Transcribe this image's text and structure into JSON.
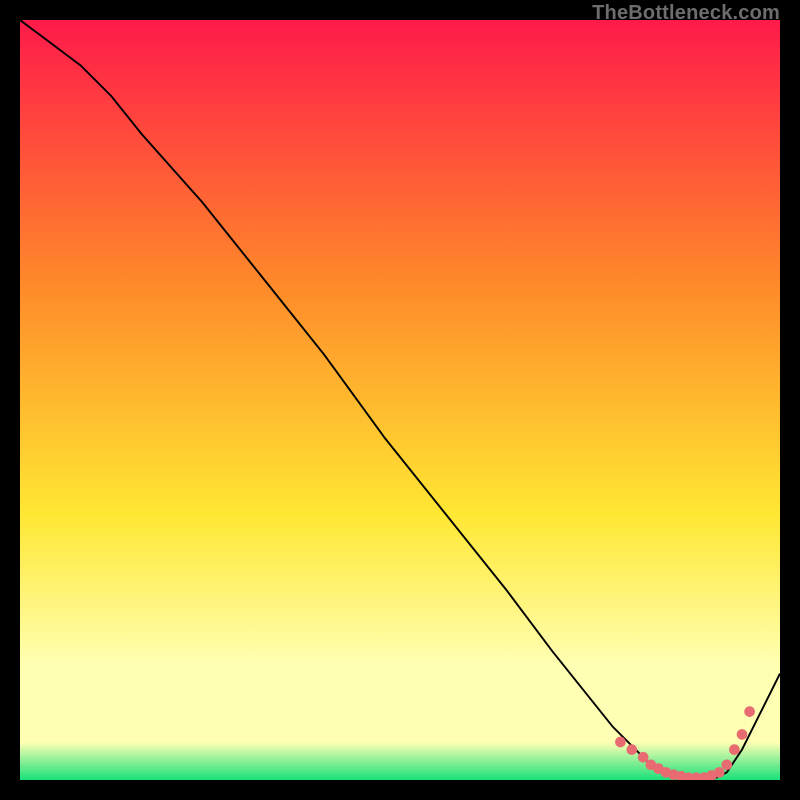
{
  "watermark": "TheBottleneck.com",
  "colors": {
    "line": "#000000",
    "dots": "#e86b72",
    "gradient_top": "#ff1a4a",
    "gradient_mid1": "#ff8a2a",
    "gradient_mid2": "#ffe733",
    "gradient_pale": "#ffffb3",
    "gradient_green": "#18e07a"
  },
  "chart_data": {
    "type": "line",
    "title": "",
    "xlabel": "",
    "ylabel": "",
    "xlim": [
      0,
      100
    ],
    "ylim": [
      0,
      100
    ],
    "grid": false,
    "series": [
      {
        "name": "curve",
        "x": [
          0,
          4,
          8,
          12,
          16,
          24,
          32,
          40,
          48,
          56,
          64,
          70,
          74,
          78,
          81,
          83,
          85,
          87,
          89,
          91,
          93,
          95,
          97,
          100
        ],
        "y": [
          100,
          97,
          94,
          90,
          85,
          76,
          66,
          56,
          45,
          35,
          25,
          17,
          12,
          7,
          4,
          2,
          1,
          0,
          0,
          0,
          1,
          4,
          8,
          14
        ]
      }
    ],
    "dots": {
      "name": "highlight-dots",
      "x": [
        79,
        80.5,
        82,
        83,
        84,
        85,
        86,
        87,
        88,
        89,
        90,
        91,
        92,
        93,
        94,
        95,
        96
      ],
      "y": [
        5,
        4,
        3,
        2,
        1.5,
        1,
        0.7,
        0.5,
        0.3,
        0.3,
        0.3,
        0.6,
        1,
        2,
        4,
        6,
        9
      ]
    }
  }
}
